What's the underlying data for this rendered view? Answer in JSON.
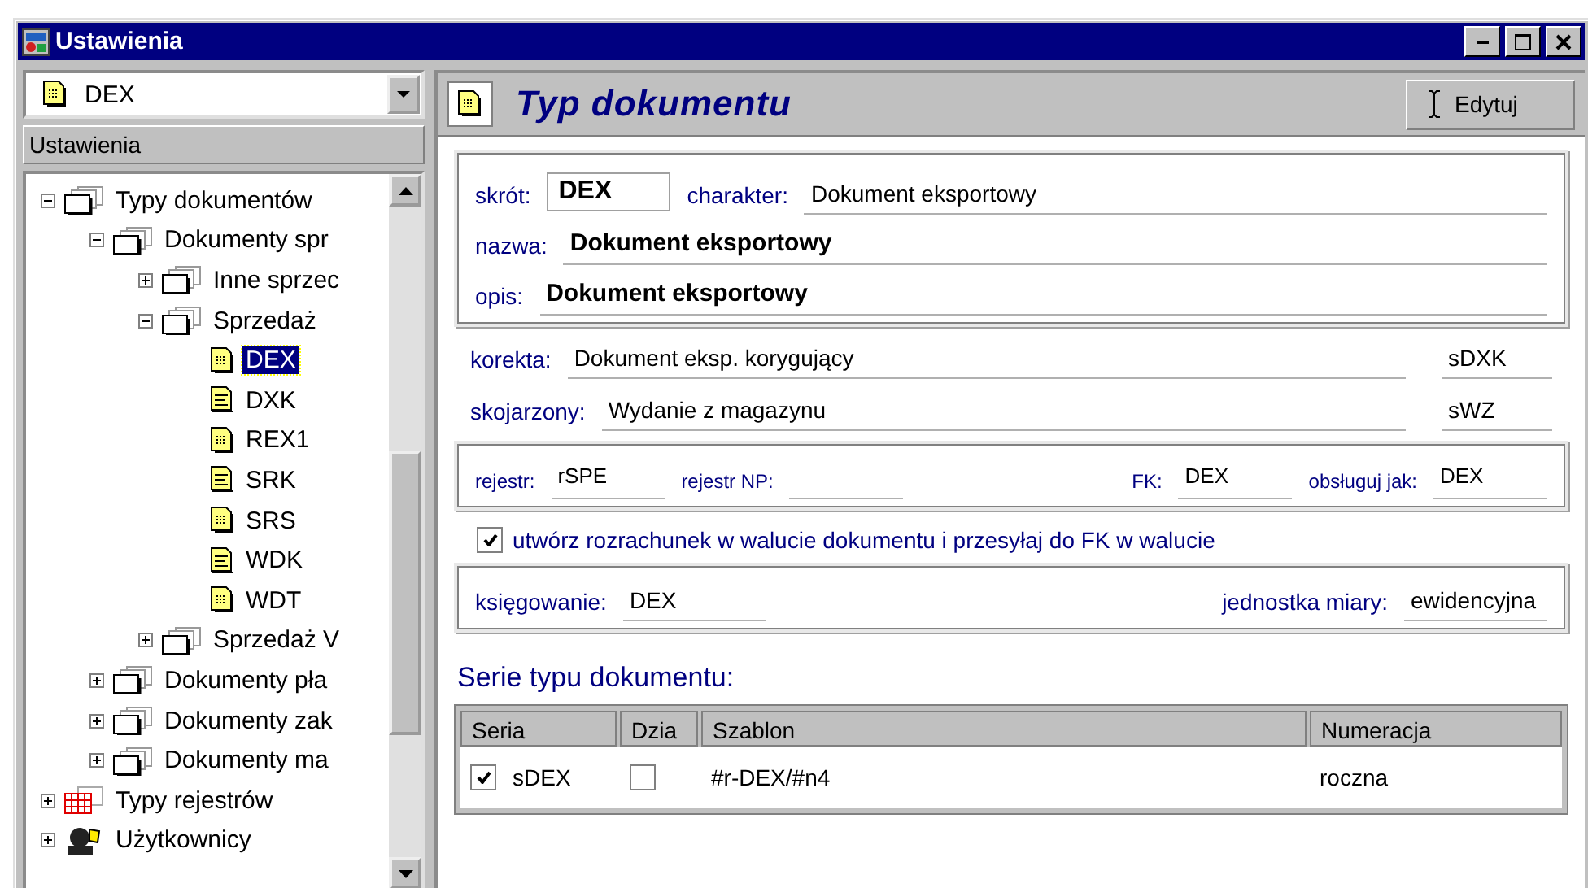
{
  "window": {
    "title": "Ustawienia"
  },
  "sidebar": {
    "combo": {
      "value": "DEX"
    },
    "header": "Ustawienia",
    "tree": [
      {
        "label": "Typy dokumentów",
        "kind": "folders",
        "expanded": true,
        "selected": false,
        "children": [
          {
            "label": "Dokumenty spr",
            "kind": "folders",
            "expanded": true,
            "selected": false,
            "children": [
              {
                "label": "Inne sprzec",
                "kind": "folders",
                "expanded": false,
                "selected": false
              },
              {
                "label": "Sprzedaż",
                "kind": "folders",
                "expanded": true,
                "selected": false,
                "children": [
                  {
                    "label": "DEX",
                    "kind": "doc",
                    "selected": true
                  },
                  {
                    "label": "DXK",
                    "kind": "doclines",
                    "selected": false
                  },
                  {
                    "label": "REX1",
                    "kind": "doc",
                    "selected": false
                  },
                  {
                    "label": "SRK",
                    "kind": "doclines",
                    "selected": false
                  },
                  {
                    "label": "SRS",
                    "kind": "doc",
                    "selected": false
                  },
                  {
                    "label": "WDK",
                    "kind": "doclines",
                    "selected": false
                  },
                  {
                    "label": "WDT",
                    "kind": "doc",
                    "selected": false
                  }
                ]
              },
              {
                "label": "Sprzedaż V",
                "kind": "folders",
                "expanded": false,
                "selected": false
              }
            ]
          },
          {
            "label": "Dokumenty pła",
            "kind": "folders",
            "expanded": false,
            "selected": false
          },
          {
            "label": "Dokumenty zak",
            "kind": "folders",
            "expanded": false,
            "selected": false
          },
          {
            "label": "Dokumenty ma",
            "kind": "folders",
            "expanded": false,
            "selected": false
          }
        ]
      },
      {
        "label": "Typy rejestrów",
        "kind": "grid",
        "expanded": false,
        "selected": false
      },
      {
        "label": "Użytkownicy",
        "kind": "user",
        "expanded": false,
        "selected": false
      }
    ]
  },
  "panel": {
    "title": "Typ dokumentu",
    "edit_button": "Edytuj",
    "main": {
      "skrot": {
        "label": "skrót:",
        "value": "DEX"
      },
      "charakter": {
        "label": "charakter:",
        "value": "Dokument eksportowy"
      },
      "nazwa": {
        "label": "nazwa:",
        "value": "Dokument eksportowy"
      },
      "opis": {
        "label": "opis:",
        "value": "Dokument eksportowy"
      }
    },
    "linked": [
      {
        "label": "korekta:",
        "value": "Dokument eksp. korygujący",
        "code": "sDXK"
      },
      {
        "label": "skojarzony:",
        "value": "Wydanie z magazynu",
        "code": "sWZ"
      }
    ],
    "registers": [
      {
        "label": "rejestr:",
        "value": "rSPE"
      },
      {
        "label": "rejestr NP:"
      },
      {
        "label": "FK:",
        "value": "DEX"
      },
      {
        "label": "obsługuj jak:",
        "value": "DEX"
      }
    ],
    "currency_option": {
      "label": "utwórz rozrachunek w walucie dokumentu i przesyłaj do FK w walucie",
      "checked": true
    },
    "posting": [
      {
        "label": "księgowanie:",
        "value": "DEX"
      },
      {
        "label": "jednostka miary:",
        "value": "ewidencyjna"
      }
    ],
    "series": {
      "title": "Serie typu dokumentu:",
      "columns": [
        "Seria",
        "Dzia",
        "Szablon",
        "Numeracja"
      ],
      "rows": [
        {
          "checked": true,
          "seria": "sDEX",
          "dzial_checked": false,
          "szablon": "#r-DEX/#n4",
          "numeracja": "roczna"
        }
      ]
    }
  }
}
